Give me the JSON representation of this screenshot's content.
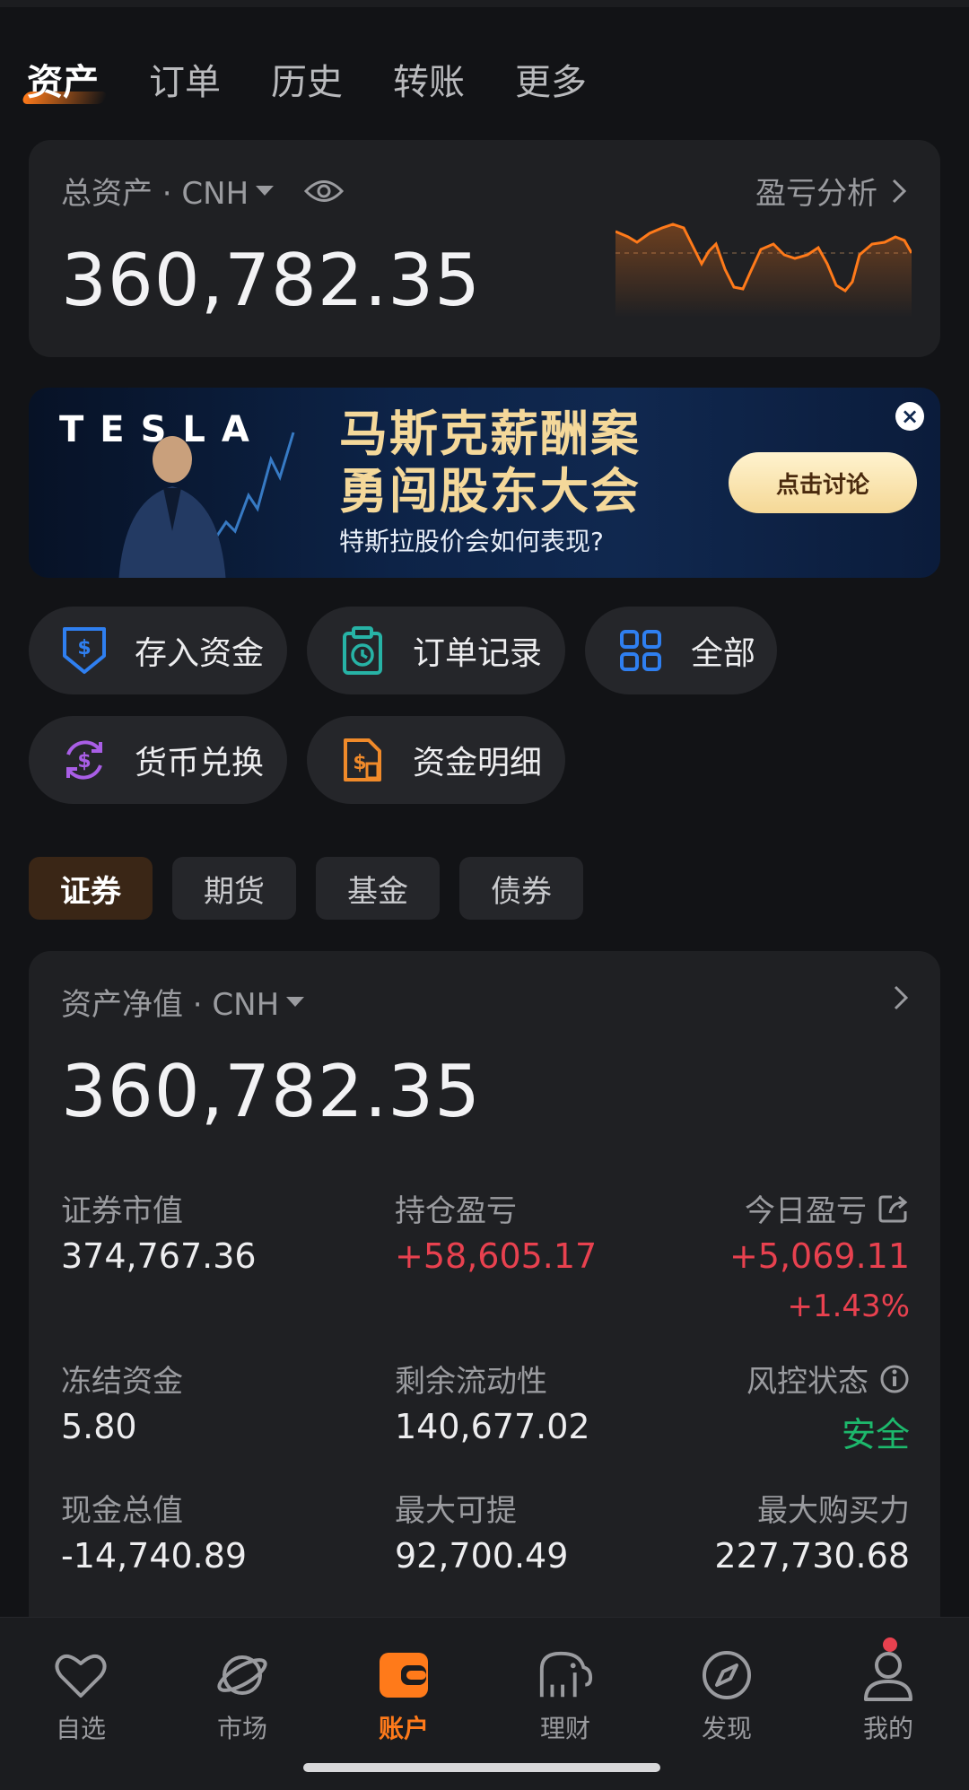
{
  "top_tabs": [
    "资产",
    "订单",
    "历史",
    "转账",
    "更多"
  ],
  "total": {
    "label": "总资产 · CNH",
    "pl_link": "盈亏分析",
    "value": "360,782.35",
    "icons": {
      "eye": "eye-icon",
      "chevron": "chevron-right-icon",
      "caret": "caret-down-icon"
    }
  },
  "banner": {
    "brand": "TESLA",
    "title_line1": "马斯克薪酬案",
    "title_line2": "勇闯股东大会",
    "subtitle": "特斯拉股价会如何表现?",
    "button": "点击讨论",
    "close": "×"
  },
  "quick_actions": [
    {
      "label": "存入资金",
      "icon": "deposit-shield-icon",
      "color": "#2f7ff0"
    },
    {
      "label": "订单记录",
      "icon": "clipboard-clock-icon",
      "color": "#27b3a6"
    },
    {
      "label": "全部",
      "icon": "grid-icon",
      "color": "#2f7ff0"
    },
    {
      "label": "货币兑换",
      "icon": "currency-exchange-icon",
      "color": "#a95ee6"
    },
    {
      "label": "资金明细",
      "icon": "fund-detail-icon",
      "color": "#f08a2a"
    }
  ],
  "categories": [
    {
      "label": "证券",
      "active": true
    },
    {
      "label": "期货",
      "active": false
    },
    {
      "label": "基金",
      "active": false
    },
    {
      "label": "债券",
      "active": false
    }
  ],
  "net": {
    "label": "资产净值 · CNH",
    "value": "360,782.35",
    "metrics": {
      "securities_value_label": "证券市值",
      "securities_value": "374,767.36",
      "position_pl_label": "持仓盈亏",
      "position_pl": "+58,605.17",
      "today_pl_label": "今日盈亏",
      "today_pl": "+5,069.11",
      "today_pl_pct": "+1.43%",
      "frozen_label": "冻结资金",
      "frozen": "5.80",
      "liquidity_label": "剩余流动性",
      "liquidity": "140,677.02",
      "risk_label": "风控状态",
      "risk": "安全",
      "cash_label": "现金总值",
      "cash": "-14,740.89",
      "max_withdraw_label": "最大可提",
      "max_withdraw": "92,700.49",
      "max_buy_label": "最大购买力",
      "max_buy": "227,730.68"
    }
  },
  "bottom_nav": [
    {
      "label": "自选",
      "icon": "heart-icon"
    },
    {
      "label": "市场",
      "icon": "planet-icon"
    },
    {
      "label": "账户",
      "icon": "wallet-icon",
      "active": true
    },
    {
      "label": "理财",
      "icon": "elephant-icon"
    },
    {
      "label": "发现",
      "icon": "compass-icon"
    },
    {
      "label": "我的",
      "icon": "user-icon"
    }
  ],
  "colors": {
    "accent": "#ff7a1a",
    "positive": "#e8414f",
    "safe": "#1db86c",
    "background": "#121316",
    "card": "#1f2023"
  }
}
